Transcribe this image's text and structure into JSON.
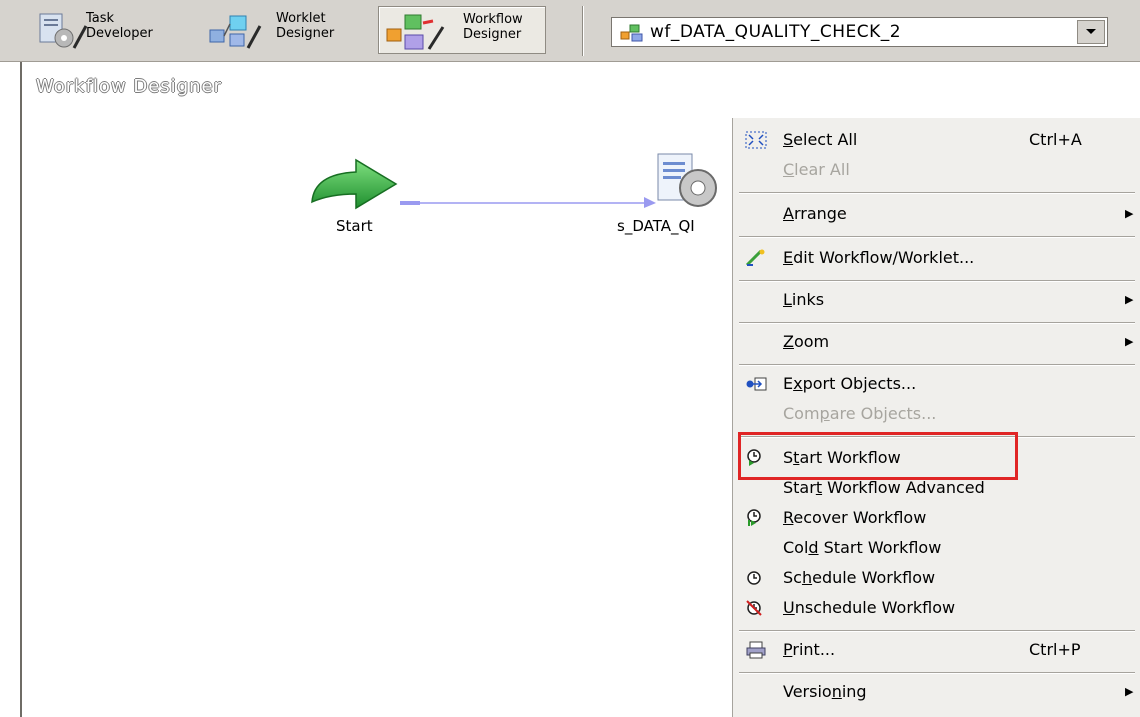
{
  "toolbar": {
    "task_developer": "Task\nDeveloper",
    "worklet_designer": "Worklet\nDesigner",
    "workflow_designer": "Workflow\nDesigner"
  },
  "workflow_selector": {
    "value": "wf_DATA_QUALITY_CHECK_2"
  },
  "canvas": {
    "title": "Workflow Designer",
    "start_node_label": "Start",
    "session_node_label": "s_DATA_QI"
  },
  "context_menu": {
    "select_all": {
      "mnemonic": "S",
      "rest": "elect All",
      "shortcut": "Ctrl+A"
    },
    "clear_all": {
      "mnemonic": "C",
      "rest": "lear All"
    },
    "arrange": {
      "mnemonic": "A",
      "rest": "rrange"
    },
    "edit_workflow": {
      "mnemonic": "E",
      "rest": "dit Workflow/Worklet..."
    },
    "links": {
      "mnemonic": "L",
      "rest": "inks"
    },
    "zoom": {
      "mnemonic": "Z",
      "rest": "oom"
    },
    "export_objects": {
      "pre": "E",
      "mnemonic": "x",
      "rest": "port Objects..."
    },
    "compare_objects": {
      "pre": "Com",
      "mnemonic": "p",
      "rest": "are Objects..."
    },
    "start_workflow": {
      "pre": "S",
      "mnemonic": "t",
      "rest": "art Workflow"
    },
    "start_workflow_advanced": {
      "pre": "Star",
      "mnemonic": "t",
      "rest": " Workflow Advanced"
    },
    "recover_workflow": {
      "mnemonic": "R",
      "rest": "ecover Workflow"
    },
    "cold_start_workflow": {
      "pre": "Col",
      "mnemonic": "d",
      "rest": " Start Workflow"
    },
    "schedule_workflow": {
      "pre": "Sc",
      "mnemonic": "h",
      "rest": "edule Workflow"
    },
    "unschedule_workflow": {
      "mnemonic": "U",
      "rest": "nschedule Workflow"
    },
    "print": {
      "mnemonic": "P",
      "rest": "rint...",
      "shortcut": "Ctrl+P"
    },
    "versioning": {
      "pre": "Versio",
      "mnemonic": "n",
      "rest": "ing"
    }
  },
  "colors": {
    "toolbar_bg": "#d6d3ce",
    "menu_bg": "#f0efec",
    "highlight_border": "#e02525",
    "link_line": "#9a9af0"
  }
}
